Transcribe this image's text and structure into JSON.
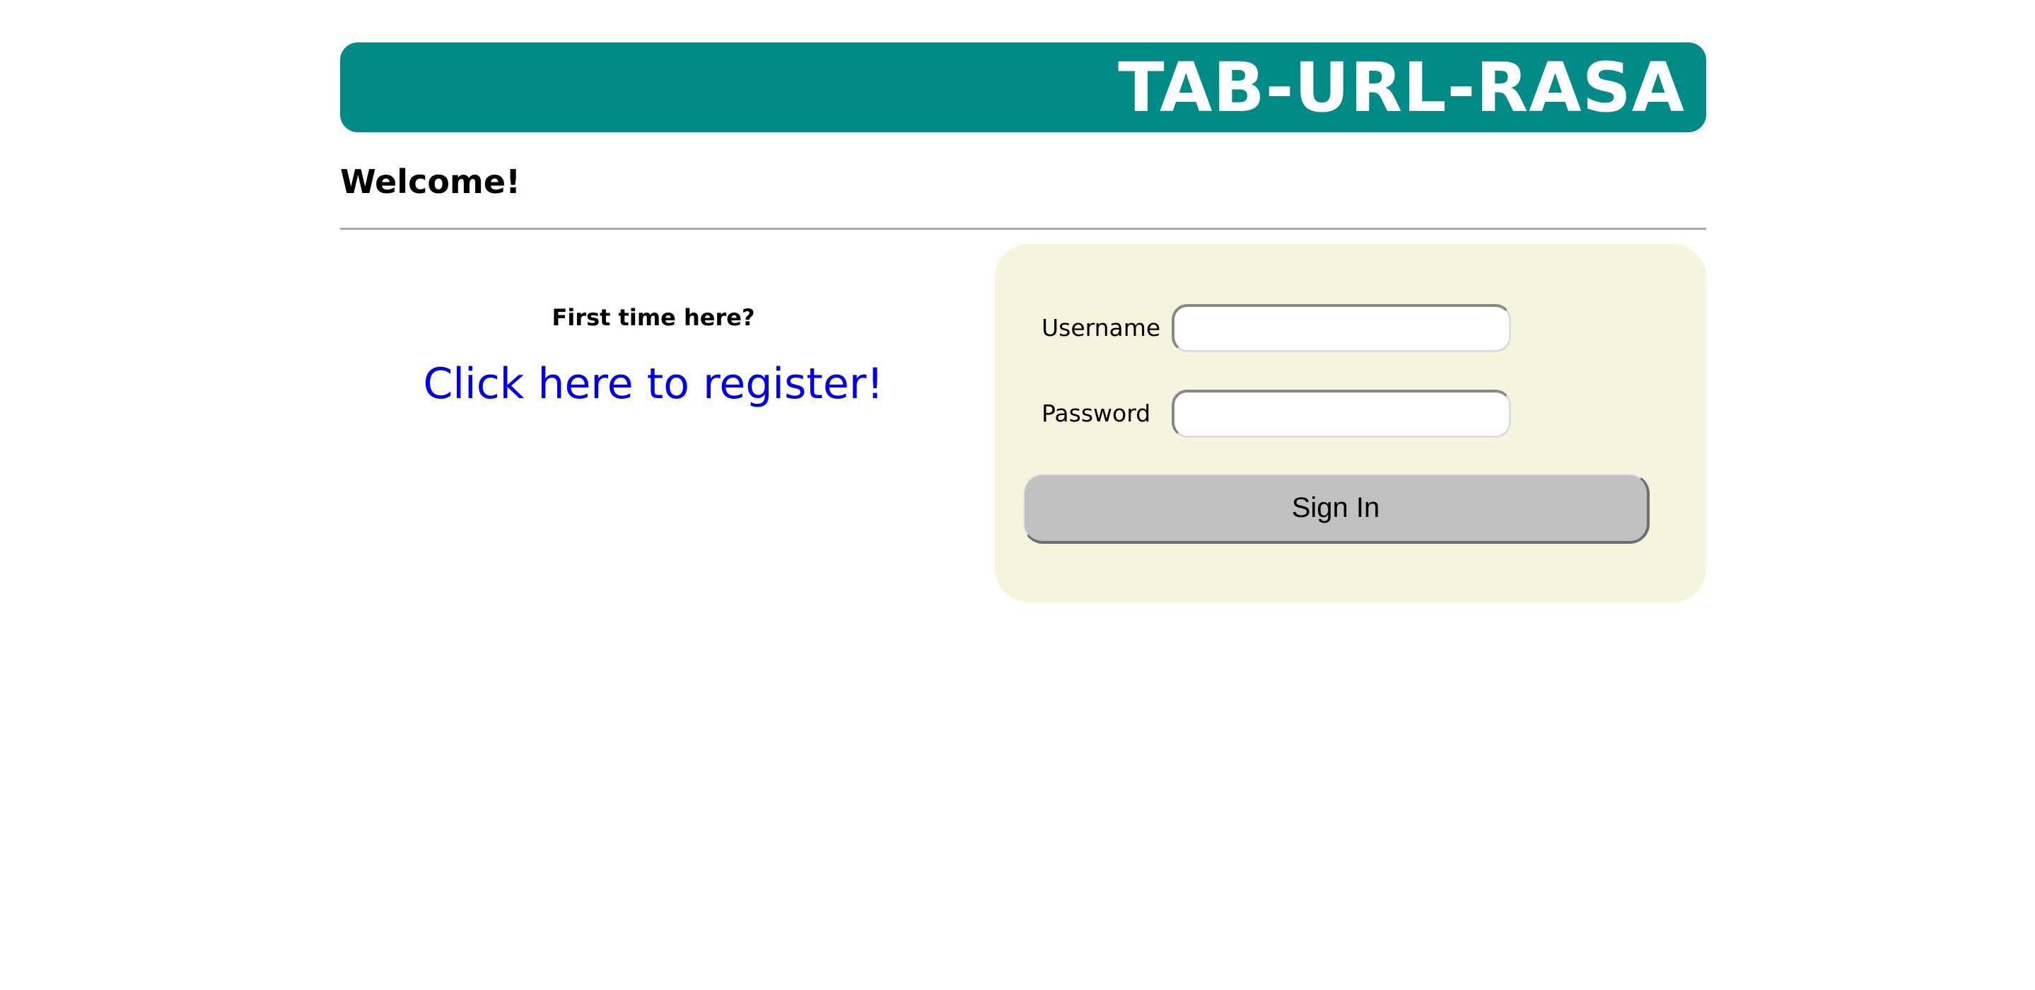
{
  "header": {
    "title": "TAB-URL-RASA"
  },
  "welcome": {
    "heading": "Welcome!"
  },
  "register": {
    "prompt": "First time here?",
    "link_label": "Click here to register!"
  },
  "login": {
    "username_label": "Username",
    "username_value": "",
    "password_label": "Password",
    "password_value": "",
    "submit_label": "Sign In"
  },
  "colors": {
    "banner": "#008b87",
    "panel": "#f5f4dc",
    "link": "#0000ee",
    "button": "#c0c0c0"
  }
}
